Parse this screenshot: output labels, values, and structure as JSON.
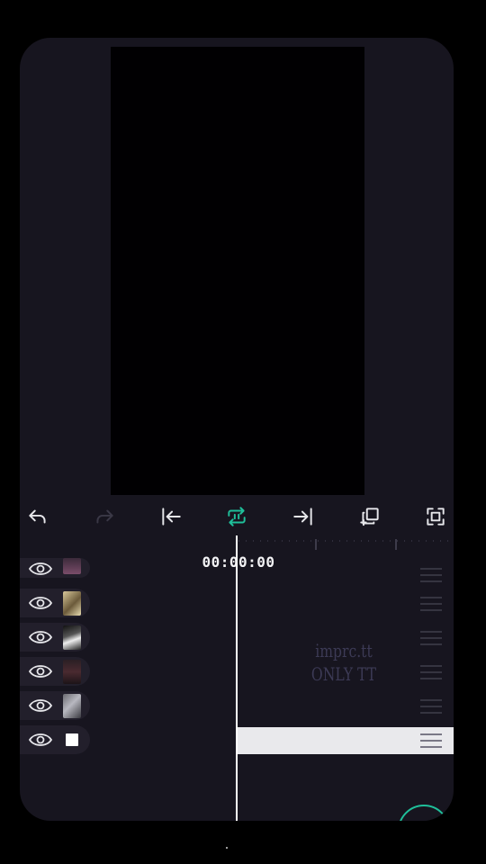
{
  "colors": {
    "frame_bg": "#17151f",
    "preview_bg": "#010002",
    "icon": "#e6e6ea",
    "icon_disabled": "#3a3846",
    "accent": "#1fbf9a",
    "playhead": "#ffffff"
  },
  "toolbar": {
    "undo_icon": "undo-icon",
    "redo_icon": "redo-icon",
    "jump_start_icon": "jump-to-start-icon",
    "loop_icon": "loop-icon",
    "jump_end_icon": "jump-to-end-icon",
    "copy_icon": "copy-layers-icon",
    "fullscreen_icon": "fullscreen-icon"
  },
  "timeline": {
    "timecode": "00:00:00"
  },
  "layers": [
    {
      "visible": true,
      "icon": "eye-icon"
    },
    {
      "visible": true,
      "icon": "eye-icon"
    },
    {
      "visible": true,
      "icon": "eye-icon"
    },
    {
      "visible": true,
      "icon": "eye-icon"
    },
    {
      "visible": true,
      "icon": "eye-icon"
    },
    {
      "visible": true,
      "icon": "eye-icon"
    }
  ],
  "watermark": {
    "line1": "imprc.tt",
    "line2": "ONLY TT"
  }
}
